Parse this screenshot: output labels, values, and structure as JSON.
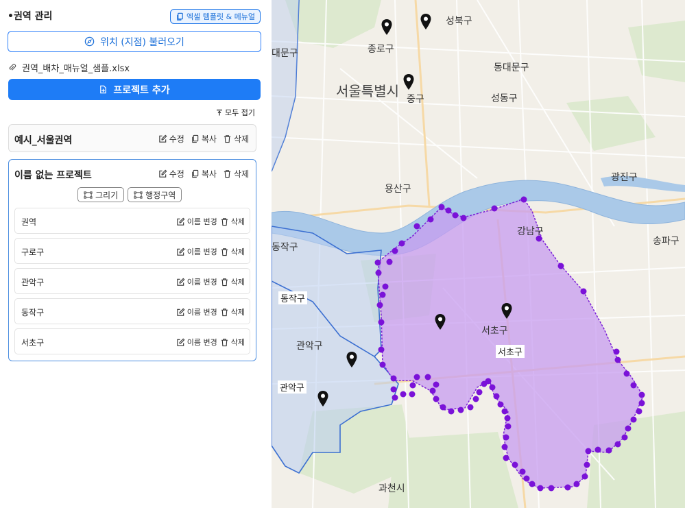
{
  "sidebar": {
    "title": "•권역 관리",
    "template_button": "엑셀 템플릿 & 메뉴얼",
    "load_location_button": "위치 (지점) 불러오기",
    "file_name": "권역_배차_매뉴얼_샘플.xlsx",
    "add_project_button": "프로젝트 추가",
    "collapse_all": "모두 접기",
    "projects": [
      {
        "name": "예시_서울권역",
        "edit": "수정",
        "copy": "복사",
        "delete": "삭제"
      },
      {
        "name": "이름 없는 프로젝트",
        "edit": "수정",
        "copy": "복사",
        "delete": "삭제",
        "draw_button": "그리기",
        "admin_area_button": "행정구역",
        "regions": [
          {
            "name": "권역",
            "rename": "이름 변경",
            "delete": "삭제"
          },
          {
            "name": "구로구",
            "rename": "이름 변경",
            "delete": "삭제"
          },
          {
            "name": "관악구",
            "rename": "이름 변경",
            "delete": "삭제"
          },
          {
            "name": "동작구",
            "rename": "이름 변경",
            "delete": "삭제"
          },
          {
            "name": "서초구",
            "rename": "이름 변경",
            "delete": "삭제"
          }
        ]
      }
    ]
  },
  "map": {
    "labels": {
      "seongbuk": "성북구",
      "jongno": "종로구",
      "dongdaemun": "동대문구",
      "seoul": "서울특별시",
      "jung": "중구",
      "seongdong": "성동구",
      "gwangjin": "광진구",
      "yongsan": "용산구",
      "gangnam": "강남구",
      "songpa": "송파구",
      "dongjak_edge": "동작구",
      "dongjak": "동작구",
      "seocho": "서초구",
      "seocho_box": "서초구",
      "gwanak": "관악구",
      "gwanak_box": "관악구",
      "gwacheon": "과천시",
      "seodaemun_edge": "대문구"
    },
    "colors": {
      "polygon_fill": "#c79cf0",
      "polygon_stroke": "#7a1fd6",
      "vertex": "#7a12d8",
      "admin_fill": "#b9cdf0",
      "admin_stroke": "#3b6fd1",
      "river": "#aac9e8"
    }
  }
}
